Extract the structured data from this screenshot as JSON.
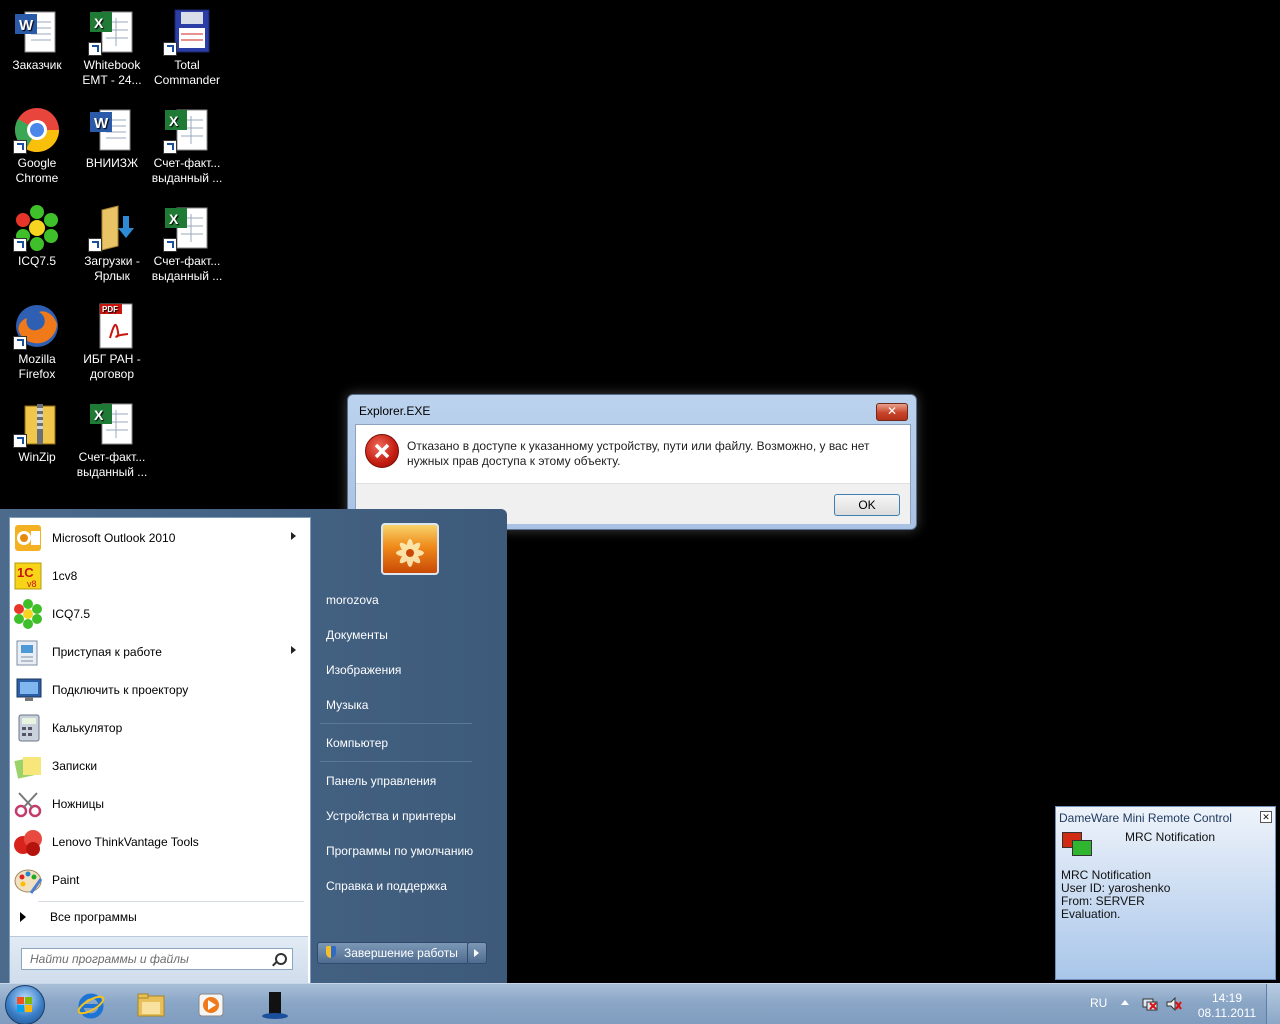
{
  "desktop": {
    "icons": [
      {
        "label": "Заказчик",
        "icon": "word-document-icon"
      },
      {
        "label": "Whitebook EMT - 24...",
        "icon": "excel-document-icon"
      },
      {
        "label": "Total Commander",
        "icon": "total-commander-icon"
      },
      {
        "label": "Google Chrome",
        "icon": "chrome-icon"
      },
      {
        "label": "ВНИИЗЖ",
        "icon": "word-document-icon"
      },
      {
        "label": "Счет-факт... выданный ...",
        "icon": "excel-document-icon"
      },
      {
        "label": "ICQ7.5",
        "icon": "icq-icon"
      },
      {
        "label": "Загрузки - Ярлык",
        "icon": "downloads-folder-icon"
      },
      {
        "label": "Счет-факт... выданный ...",
        "icon": "excel-document-icon"
      },
      {
        "label": "Mozilla Firefox",
        "icon": "firefox-icon"
      },
      {
        "label": "ИБГ РАН - договор",
        "icon": "pdf-document-icon"
      },
      {
        "label": "WinZip",
        "icon": "winzip-icon"
      },
      {
        "label": "Счет-факт... выданный ...",
        "icon": "excel-document-icon"
      }
    ]
  },
  "dialog": {
    "title": "Explorer.EXE",
    "close_label": "✕",
    "message": "Отказано в доступе к указанному устройству, пути или файлу. Возможно,  у вас нет нужных прав доступа к этому объекту.",
    "ok_label": "OK"
  },
  "start_menu": {
    "programs": [
      {
        "label": "Microsoft Outlook 2010",
        "icon": "outlook-icon",
        "submenu": true
      },
      {
        "label": "1cv8",
        "icon": "1c-icon",
        "submenu": false
      },
      {
        "label": "ICQ7.5",
        "icon": "icq-icon",
        "submenu": false
      },
      {
        "label": "Приступая к работе",
        "icon": "getting-started-icon",
        "submenu": true
      },
      {
        "label": "Подключить к проектору",
        "icon": "projector-icon",
        "submenu": false
      },
      {
        "label": "Калькулятор",
        "icon": "calculator-icon",
        "submenu": false
      },
      {
        "label": "Записки",
        "icon": "sticky-notes-icon",
        "submenu": false
      },
      {
        "label": "Ножницы",
        "icon": "snipping-tool-icon",
        "submenu": false
      },
      {
        "label": "Lenovo ThinkVantage Tools",
        "icon": "lenovo-tools-icon",
        "submenu": false
      },
      {
        "label": "Paint",
        "icon": "paint-icon",
        "submenu": false
      }
    ],
    "all_programs_label": "Все программы",
    "search_placeholder": "Найти программы и файлы",
    "right_items": [
      "morozova",
      "Документы",
      "Изображения",
      "Музыка",
      "Компьютер",
      "Панель управления",
      "Устройства и принтеры",
      "Программы по умолчанию",
      "Справка и поддержка"
    ],
    "shutdown_label": "Завершение работы"
  },
  "notification": {
    "title": "DameWare Mini Remote Control",
    "subtitle": "MRC Notification",
    "lines": [
      "MRC Notification",
      "User ID: yaroshenko",
      "From: SERVER",
      "Evaluation."
    ]
  },
  "taskbar": {
    "pinned": [
      "internet-explorer-icon",
      "windows-explorer-icon",
      "media-player-icon",
      "app-icon"
    ],
    "language": "RU",
    "time": "14:19",
    "date": "08.11.2011"
  },
  "colors": {
    "error_red": "#c31c10",
    "taskbar_blue": "#8aa6c6",
    "start_menu_blue": "#4b6a8c"
  }
}
